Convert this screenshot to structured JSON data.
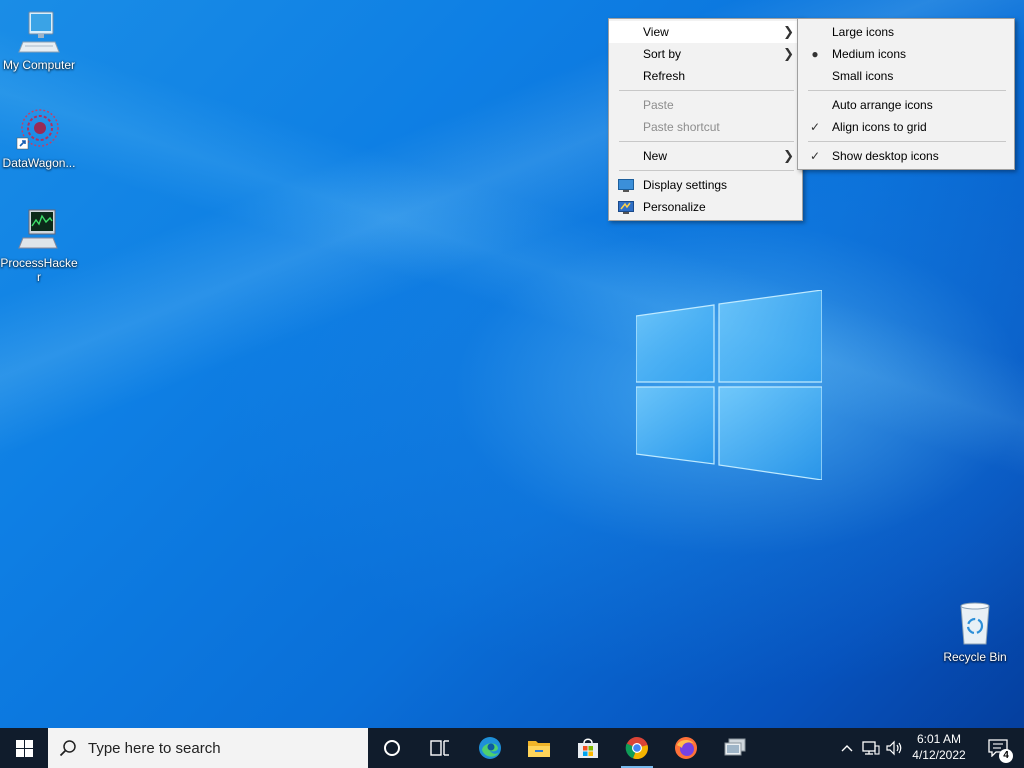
{
  "desktop": {
    "icons": [
      {
        "label": "My Computer"
      },
      {
        "label": "DataWagon..."
      },
      {
        "label": "ProcessHacker"
      },
      {
        "label": "Recycle Bin"
      }
    ]
  },
  "context_menu": {
    "items": {
      "view": "View",
      "sort_by": "Sort by",
      "refresh": "Refresh",
      "paste": "Paste",
      "paste_shortcut": "Paste shortcut",
      "new": "New",
      "display_settings": "Display settings",
      "personalize": "Personalize"
    }
  },
  "view_submenu": {
    "items": {
      "large_icons": "Large icons",
      "medium_icons": "Medium icons",
      "small_icons": "Small icons",
      "auto_arrange": "Auto arrange icons",
      "align_to_grid": "Align icons to grid",
      "show_desktop_icons": "Show desktop icons"
    },
    "selected_size": "Medium icons",
    "checked": [
      "Align icons to grid",
      "Show desktop icons"
    ]
  },
  "taskbar": {
    "search_placeholder": "Type here to search",
    "apps": [
      "cortana",
      "task-view",
      "edge",
      "file-explorer",
      "microsoft-store",
      "chrome",
      "firefox",
      "remote-desktop"
    ],
    "active_app": "chrome",
    "clock": {
      "time": "6:01 AM",
      "date": "4/12/2022"
    },
    "notification_count": "4"
  },
  "colors": {
    "taskbar_bg": "#101c2c",
    "accent": "#76b9ed",
    "menu_bg": "#f2f2f2"
  }
}
